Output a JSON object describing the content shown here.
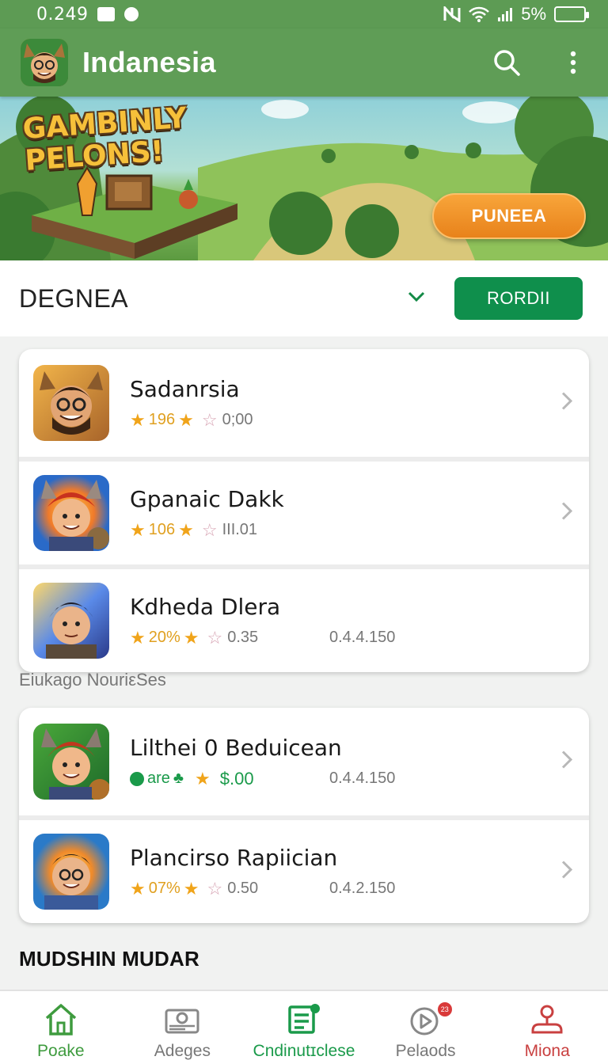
{
  "status_bar": {
    "time": "0.249",
    "battery": "5%"
  },
  "app_bar": {
    "title": "Indanesia",
    "search_icon": "search-icon",
    "menu_icon": "more-vert-icon"
  },
  "banner": {
    "headline_line1": "GAMBINLY",
    "headline_line2": "PELONS!",
    "cta_label": "PUNEEA"
  },
  "category": {
    "title": "DEGNEA",
    "button_label": "RORDII"
  },
  "list_a": [
    {
      "name": "Sadanrsia",
      "rating": "196",
      "secondary": "0;00",
      "version": ""
    },
    {
      "name": "Gpanaic Dakk",
      "rating": "106",
      "secondary": "III.01",
      "version": ""
    },
    {
      "name": "Kdheda Dlera",
      "rating": "20%",
      "secondary": "0.35",
      "version": "0.4.4.150"
    }
  ],
  "section_label": "Eiukago NouriεSes",
  "list_b": [
    {
      "name": "Lilthei 0 Beduicean",
      "status": "are",
      "price": "$.00",
      "version": "0.4.4.150"
    },
    {
      "name": "Plancirso Rapiician",
      "rating": "07%",
      "secondary": "0.50",
      "version": "0.4.2.150"
    }
  ],
  "section_bottom": "MUDSHIN MUDAR",
  "bottom_nav": [
    {
      "label": "Poake",
      "icon": "home-icon"
    },
    {
      "label": "Adeges",
      "icon": "gallery-icon"
    },
    {
      "label": "Cndinutɪclese",
      "icon": "list-icon"
    },
    {
      "label": "Pelaods",
      "icon": "play-icon",
      "badge": "23"
    },
    {
      "label": "Miona",
      "icon": "joystick-icon"
    }
  ],
  "colors": {
    "appbar": "#5f9d56",
    "accent_green": "#0f8f4c",
    "cta_orange": "#f39a2e",
    "star": "#f0a41a"
  }
}
